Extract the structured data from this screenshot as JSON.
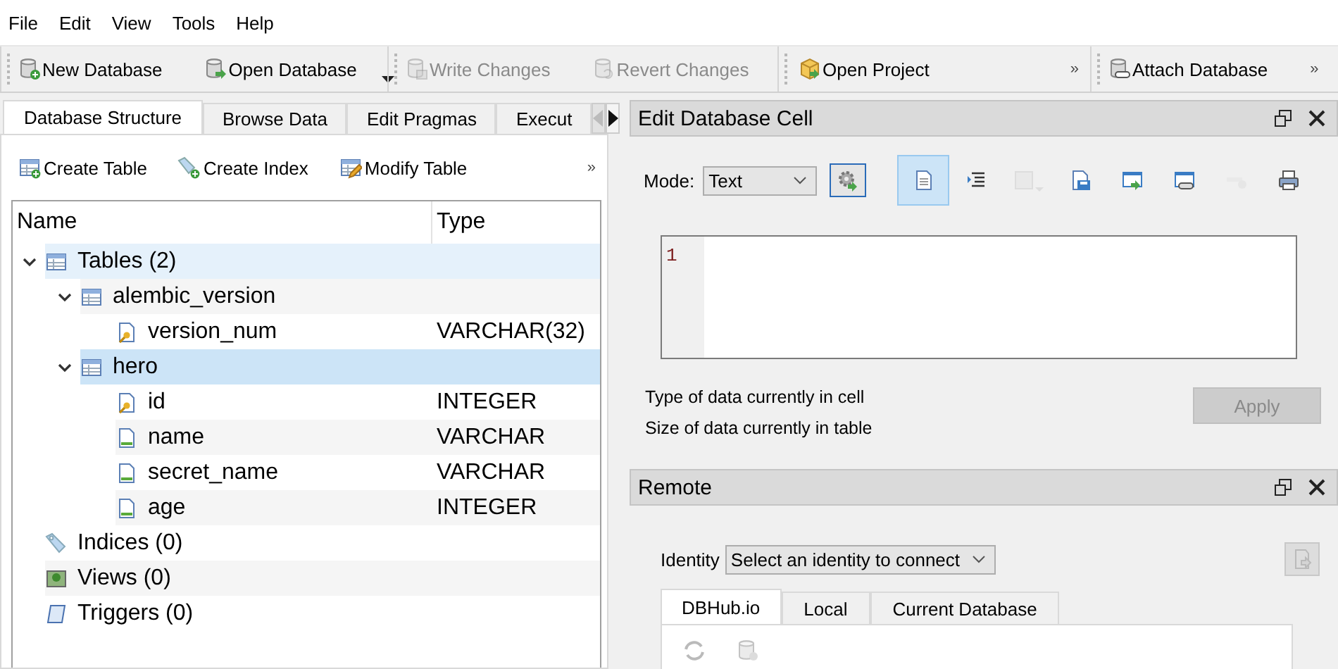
{
  "menu": [
    "File",
    "Edit",
    "View",
    "Tools",
    "Help"
  ],
  "toolbar_groups": [
    {
      "buttons": [
        {
          "label": "New Database",
          "disabled": false
        },
        {
          "label": "Open Database",
          "disabled": false,
          "menu": true
        }
      ]
    },
    {
      "buttons": [
        {
          "label": "Write Changes",
          "disabled": true
        },
        {
          "label": "Revert Changes",
          "disabled": true
        }
      ]
    },
    {
      "buttons": [
        {
          "label": "Open Project",
          "disabled": false
        }
      ],
      "overflow": "»"
    },
    {
      "buttons": [
        {
          "label": "Attach Database",
          "disabled": false
        }
      ],
      "overflow": "»"
    }
  ],
  "tabs": [
    {
      "label": "Database Structure",
      "selected": true
    },
    {
      "label": "Browse Data",
      "selected": false
    },
    {
      "label": "Edit Pragmas",
      "selected": false
    },
    {
      "label": "Execut",
      "selected": false
    }
  ],
  "structure_toolbar": {
    "buttons": [
      "Create Table",
      "Create Index",
      "Modify Table"
    ],
    "overflow": "»"
  },
  "tree": {
    "columns": [
      "Name",
      "Type"
    ],
    "nodes": [
      {
        "kind": "tables",
        "name": "Tables (2)",
        "expanded": true,
        "selected": false,
        "hovered": true,
        "children": [
          {
            "kind": "table",
            "name": "alembic_version",
            "expanded": true,
            "selected": false,
            "hovered": false,
            "children": [
              {
                "kind": "key",
                "name": "version_num",
                "type": "VARCHAR(32)",
                "selected": false,
                "hovered": false
              }
            ]
          },
          {
            "kind": "table",
            "name": "hero",
            "expanded": true,
            "selected": true,
            "hovered": false,
            "children": [
              {
                "kind": "key",
                "name": "id",
                "type": "INTEGER",
                "selected": false,
                "hovered": false
              },
              {
                "kind": "column",
                "name": "name",
                "type": "VARCHAR",
                "selected": false,
                "hovered": false
              },
              {
                "kind": "column",
                "name": "secret_name",
                "type": "VARCHAR",
                "selected": false,
                "hovered": false
              },
              {
                "kind": "column",
                "name": "age",
                "type": "INTEGER",
                "selected": false,
                "hovered": false
              }
            ]
          }
        ]
      },
      {
        "kind": "indices",
        "name": "Indices (0)",
        "selected": false,
        "hovered": false
      },
      {
        "kind": "views",
        "name": "Views (0)",
        "selected": false,
        "hovered": false
      },
      {
        "kind": "triggers",
        "name": "Triggers (0)",
        "selected": false,
        "hovered": false
      }
    ]
  },
  "cell_editor": {
    "title": "Edit Database Cell",
    "mode_label": "Mode:",
    "mode": "Text",
    "buttons": [
      {
        "selected": true,
        "disabled": false
      },
      {
        "selected": false,
        "disabled": false
      },
      {
        "selected": false,
        "disabled": true
      },
      {
        "selected": false,
        "disabled": false
      },
      {
        "selected": false,
        "disabled": false
      },
      {
        "selected": false,
        "disabled": false
      },
      {
        "selected": false,
        "disabled": true
      },
      {
        "selected": false,
        "disabled": false
      }
    ],
    "line_number": "1",
    "type_info": "Type of data currently in cell",
    "size_info": "Size of data currently in table",
    "apply": {
      "label": "Apply",
      "disabled": true
    }
  },
  "remote": {
    "title": "Remote",
    "identity_label": "Identity",
    "identity": "Select an identity to connect",
    "tabs": [
      {
        "label": "DBHub.io",
        "selected": true
      },
      {
        "label": "Local",
        "selected": false
      },
      {
        "label": "Current Database",
        "selected": false
      }
    ]
  }
}
